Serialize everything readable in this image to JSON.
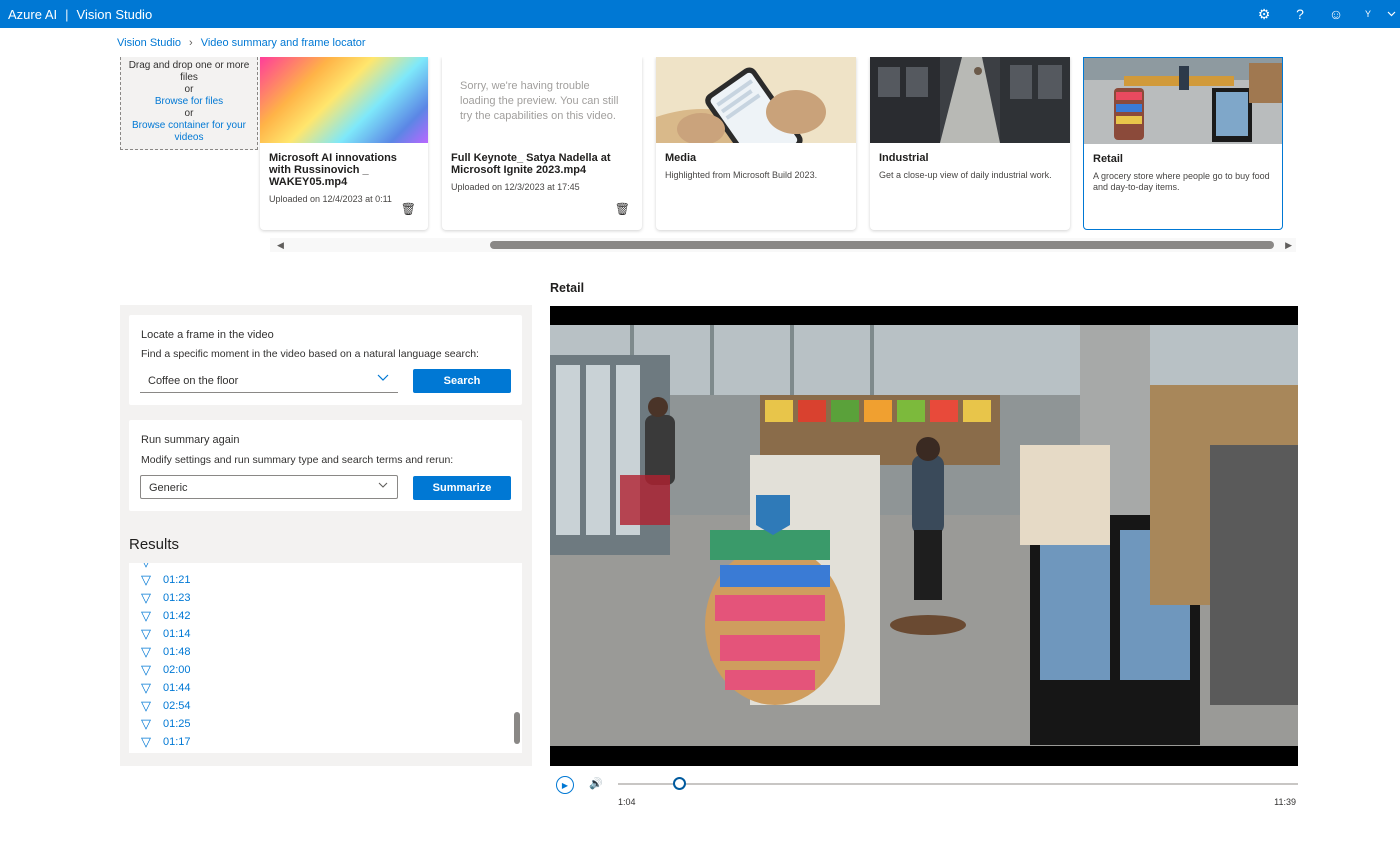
{
  "app": {
    "brand": "Azure AI",
    "separator": "|",
    "product": "Vision Studio"
  },
  "header_icons": [
    "gear-icon",
    "help-icon",
    "smiley-icon",
    "user-avatar",
    "chevron-down-icon"
  ],
  "user_initial": "Y",
  "breadcrumb": {
    "root": "Vision Studio",
    "current": "Video summary and frame locator"
  },
  "upload": {
    "line1": "Drag and drop one or more files",
    "or1": "or",
    "browse_files": "Browse for files",
    "or2": "or",
    "browse_container": "Browse container for your videos"
  },
  "cards": [
    {
      "title": "Microsoft AI innovations with Russinovich _ WAKEY05.mp4",
      "subtitle": "Uploaded on 12/4/2023 at 0:11"
    },
    {
      "title": "Full Keynote_ Satya Nadella at Microsoft Ignite 2023.mp4",
      "subtitle": "Uploaded on 12/3/2023 at 17:45",
      "error": "Sorry, we're having trouble loading the preview. You can still try the capabilities on this video."
    },
    {
      "title": "Media",
      "desc": "Highlighted from Microsoft Build 2023."
    },
    {
      "title": "Industrial",
      "desc": "Get a close-up view of daily industrial work."
    },
    {
      "title": "Retail",
      "desc": "A grocery store where people go to buy food and day-to-day items."
    }
  ],
  "locate": {
    "heading": "Locate a frame in the video",
    "sub": "Find a specific moment in the video based on a natural language search:",
    "value": "Coffee on the floor",
    "button": "Search"
  },
  "summary": {
    "heading": "Run summary again",
    "sub": "Modify settings and run summary type and search terms and rerun:",
    "value": "Generic",
    "button": "Summarize"
  },
  "results": {
    "title": "Results",
    "items": [
      "01:21",
      "01:23",
      "01:42",
      "01:14",
      "01:48",
      "02:00",
      "01:44",
      "02:54",
      "01:25",
      "01:17"
    ]
  },
  "video": {
    "title": "Retail",
    "current_time": "1:04",
    "duration": "11:39",
    "progress": 0.09
  },
  "colors": {
    "accent": "#0078d4",
    "panel_bg": "#f3f2f1"
  }
}
